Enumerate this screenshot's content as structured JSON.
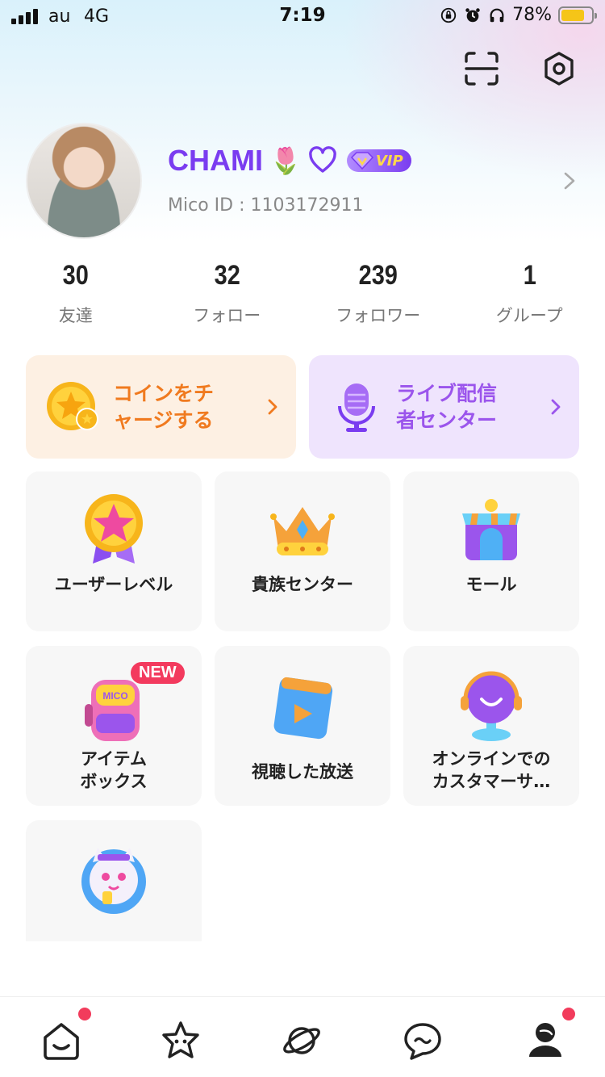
{
  "status_bar": {
    "carrier": "au",
    "network": "4G",
    "time": "7:19",
    "battery": "78%",
    "battery_level": 0.78
  },
  "header": {
    "scan_icon": "scan-icon",
    "settings_icon": "settings-icon"
  },
  "profile": {
    "name": "CHAMI",
    "name_emoji": "🌷",
    "vip_label": "VIP",
    "mico_id": "Mico ID : 1103172911"
  },
  "stats": [
    {
      "value": "30",
      "label": "友達"
    },
    {
      "value": "32",
      "label": "フォロー"
    },
    {
      "value": "239",
      "label": "フォロワー"
    },
    {
      "value": "1",
      "label": "グループ"
    }
  ],
  "promo_cards": {
    "coin": {
      "line1": "コインをチ",
      "line2": "ャージする"
    },
    "live": {
      "line1": "ライブ配信",
      "line2": "者センター"
    }
  },
  "tiles": [
    {
      "label": "ユーザーレベル"
    },
    {
      "label": "貴族センター"
    },
    {
      "label": "モール"
    },
    {
      "line1": "アイテム",
      "line2": "ボックス",
      "badge": "NEW"
    },
    {
      "label": "視聴した放送"
    },
    {
      "line1": "オンラインでの",
      "line2": "カスタマーサ…"
    }
  ],
  "bottom_nav": [
    {
      "icon": "home-icon",
      "has_dot": true
    },
    {
      "icon": "star-face-icon",
      "has_dot": false
    },
    {
      "icon": "planet-icon",
      "has_dot": false
    },
    {
      "icon": "chat-icon",
      "has_dot": false
    },
    {
      "icon": "profile-icon",
      "has_dot": true,
      "active": true
    }
  ],
  "colors": {
    "accent_purple": "#7a3cf0",
    "coin_orange": "#f07a1f",
    "badge_red": "#f33a5e"
  }
}
